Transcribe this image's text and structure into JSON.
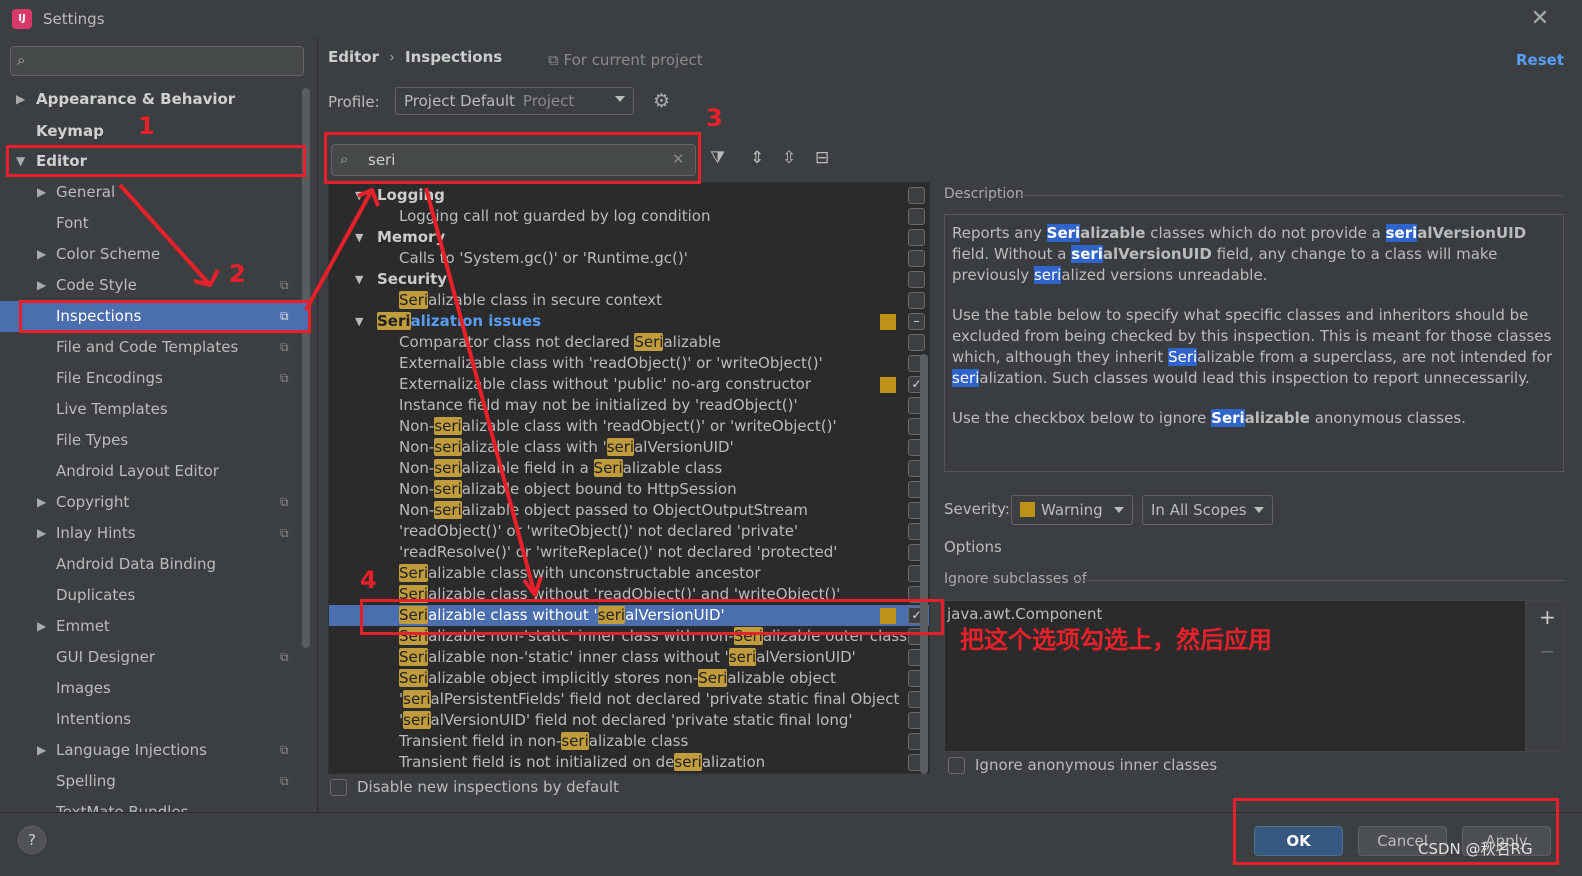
{
  "window": {
    "title": "Settings",
    "logo": "IJ"
  },
  "sidebar": {
    "search_placeholder": "",
    "items": [
      {
        "label": "Appearance & Behavior",
        "arrow": "▶"
      },
      {
        "label": "Keymap"
      },
      {
        "label": "Editor",
        "arrow": "▼"
      },
      {
        "label": "General",
        "arrow": "▶"
      },
      {
        "label": "Font"
      },
      {
        "label": "Color Scheme",
        "arrow": "▶"
      },
      {
        "label": "Code Style",
        "arrow": "▶"
      },
      {
        "label": "Inspections"
      },
      {
        "label": "File and Code Templates"
      },
      {
        "label": "File Encodings"
      },
      {
        "label": "Live Templates"
      },
      {
        "label": "File Types"
      },
      {
        "label": "Android Layout Editor"
      },
      {
        "label": "Copyright",
        "arrow": "▶"
      },
      {
        "label": "Inlay Hints",
        "arrow": "▶"
      },
      {
        "label": "Android Data Binding"
      },
      {
        "label": "Duplicates"
      },
      {
        "label": "Emmet",
        "arrow": "▶"
      },
      {
        "label": "GUI Designer"
      },
      {
        "label": "Images"
      },
      {
        "label": "Intentions"
      },
      {
        "label": "Language Injections",
        "arrow": "▶"
      },
      {
        "label": "Spelling"
      },
      {
        "label": "TextMate Bundles"
      }
    ]
  },
  "header": {
    "crumb1": "Editor",
    "crumb_sep": "›",
    "crumb2": "Inspections",
    "for_project": "For current project",
    "reset": "Reset"
  },
  "profile": {
    "label": "Profile:",
    "value": "Project Default",
    "scope": "Project"
  },
  "search": {
    "value": "seri",
    "clear": "✕"
  },
  "tree": {
    "rows": [
      {
        "text": "Logging"
      },
      {
        "text": "Logging call not guarded by log condition"
      },
      {
        "text": "Memory"
      },
      {
        "text": "Calls to 'System.gc()' or 'Runtime.gc()'"
      },
      {
        "text": "Security"
      },
      {
        "p1": "Seri",
        "p2": "alizable class in secure context"
      },
      {
        "p1": "Seri",
        "p2": "alization issues"
      },
      {
        "p1": "Comparator class not declared ",
        "p2": "Seri",
        "p3": "alizable"
      },
      {
        "text": "Externalizable class with 'readObject()' or 'writeObject()'"
      },
      {
        "text": "Externalizable class without 'public' no-arg constructor"
      },
      {
        "text": "Instance field may not be initialized by 'readObject()'"
      },
      {
        "p1": "Non-",
        "p2": "seri",
        "p3": "alizable class with 'readObject()' or 'writeObject()'"
      },
      {
        "p1": "Non-",
        "p2": "seri",
        "p3": "alizable class with '",
        "p4": "seri",
        "p5": "alVersionUID'"
      },
      {
        "p1": "Non-",
        "p2": "seri",
        "p3": "alizable field in a ",
        "p4": "Seri",
        "p5": "alizable class"
      },
      {
        "p1": "Non-",
        "p2": "seri",
        "p3": "alizable object bound to HttpSession"
      },
      {
        "p1": "Non-",
        "p2": "seri",
        "p3": "alizable object passed to ObjectOutputStream"
      },
      {
        "text": "'readObject()' or 'writeObject()' not declared 'private'"
      },
      {
        "text": "'readResolve()' or 'writeReplace()' not declared 'protected'"
      },
      {
        "p1": "Seri",
        "p2": "alizable class with unconstructable ancestor"
      },
      {
        "p1": "Seri",
        "p2": "alizable class without 'readObject()' and 'writeObject()'"
      },
      {
        "p1": "Seri",
        "p2": "alizable class without '",
        "p3": "seri",
        "p4": "alVersionUID'"
      },
      {
        "p1": "Seri",
        "p2": "alizable non-'static' inner class with non-",
        "p3": "Seri",
        "p4": "alizable outer class"
      },
      {
        "p1": "Seri",
        "p2": "alizable non-'static' inner class without '",
        "p3": "seri",
        "p4": "alVersionUID'"
      },
      {
        "p1": "Seri",
        "p2": "alizable object implicitly stores non-",
        "p3": "Seri",
        "p4": "alizable object"
      },
      {
        "p1": "'",
        "p2": "seri",
        "p3": "alPersistentFields' field not declared 'private static final Object"
      },
      {
        "p1": "'",
        "p2": "seri",
        "p3": "alVersionUID' field not declared 'private static final long'"
      },
      {
        "p1": "Transient field in non-",
        "p2": "seri",
        "p3": "alizable class"
      },
      {
        "p1": "Transient field is not initialized on de",
        "p2": "seri",
        "p3": "alization"
      }
    ],
    "check_mark": "✓",
    "dash_mark": "–"
  },
  "disable_new": "Disable new inspections by default",
  "description": {
    "label": "Description",
    "p1": {
      "a": "Reports any ",
      "b": "Seri",
      "c": "alizable",
      "d": " classes which do not provide a ",
      "e": "seri",
      "f": "alVersionUID",
      "g": " field. Without a ",
      "h": "seri",
      "i": "alVersionUID",
      "j": " field, any change to a class will make previously ",
      "k": "seri",
      "l": "alized versions unreadable."
    },
    "p2": {
      "a": "Use the table below to specify what specific classes and inheritors should be excluded from being checked by this inspection. This is meant for those classes which, although they inherit ",
      "b": "Seri",
      "c": "alizable from a superclass, are not intended for ",
      "d": "seri",
      "e": "alization. Such classes would lead this inspection to report unnecessarily."
    },
    "p3": {
      "a": "Use the checkbox below to ignore ",
      "b": "Seri",
      "c": "alizable",
      "d": " anonymous classes."
    }
  },
  "severity": {
    "label": "Severity:",
    "value": "Warning",
    "scope": "In All Scopes",
    "color": "#be9117"
  },
  "options": {
    "label": "Options",
    "ignore_label": "Ignore subclasses of",
    "items": [
      "java.awt.Component"
    ],
    "plus": "+",
    "minus": "−",
    "anon": "Ignore anonymous inner classes"
  },
  "buttons": {
    "help": "?",
    "ok": "OK",
    "cancel": "Cancel",
    "apply": "Apply"
  },
  "annotations": {
    "n1": "1",
    "n2": "2",
    "n3": "3",
    "n4": "4",
    "note": "把这个选项勾选上，然后应用",
    "watermark": "CSDN @秋名RG"
  }
}
